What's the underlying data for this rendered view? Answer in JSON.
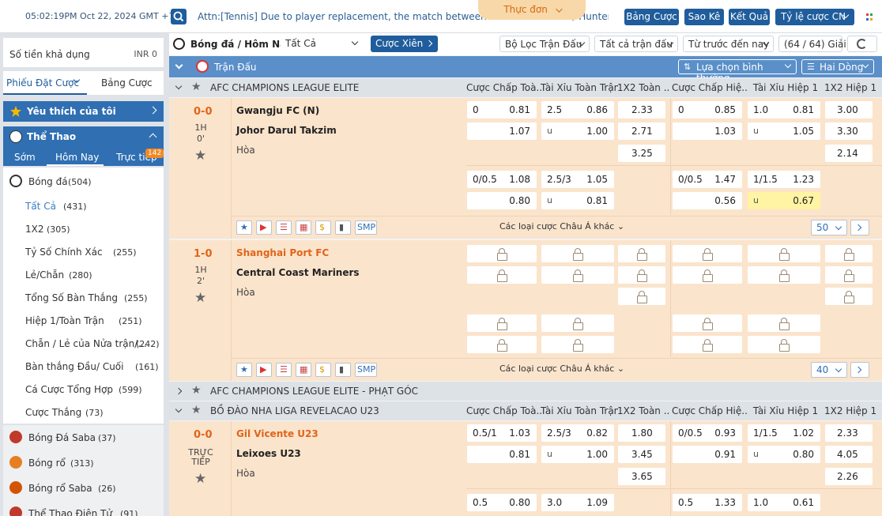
{
  "topbar": {
    "time": "05:02:19PM Oct 22, 2024 GMT +7",
    "marquee": "Attn:[Tennis] Due to player replacement, the match between \"Didi Bredenbach/ Hunter Heck\" vs- Tian",
    "menu_label": "Thực đơn",
    "buttons": [
      "Bảng Cược",
      "Sao Kê",
      "Kết Quả",
      "Tỷ lệ cược CN"
    ]
  },
  "sidebar": {
    "balance_label": "Số tiền khả dụng",
    "balance_value": "INR 0",
    "tabs": [
      "Phiếu Đặt Cược",
      "Bảng Cược"
    ],
    "favorites": "Yêu thích của tôi",
    "sports_title": "Thể Thao",
    "sport_tabs": [
      "Sớm",
      "Hôm Nay",
      "Trực tiếp"
    ],
    "live_badge": "142",
    "football": {
      "label": "Bóng đá",
      "count": "(504)"
    },
    "sub_items": [
      {
        "label": "Tất Cả",
        "count": "(431)"
      },
      {
        "label": "1X2",
        "count": "(305)"
      },
      {
        "label": "Tỷ Số Chính Xác",
        "count": "(255)"
      },
      {
        "label": "Lẻ/Chẵn",
        "count": "(280)"
      },
      {
        "label": "Tổng Số Bàn Thắng",
        "count": "(255)"
      },
      {
        "label": "Hiệp 1/Toàn Trận",
        "count": "(251)"
      },
      {
        "label": "Chẵn / Lẻ của Nửa trận/...",
        "count": "(242)"
      },
      {
        "label": "Bàn thắng Đầu/ Cuối",
        "count": "(161)"
      },
      {
        "label": "Cá Cược Tổng Hợp",
        "count": "(599)"
      },
      {
        "label": "Cược Thắng",
        "count": "(73)"
      }
    ],
    "sports": [
      {
        "label": "Bóng Đá Saba",
        "count": "(37)"
      },
      {
        "label": "Bóng rổ",
        "count": "(313)"
      },
      {
        "label": "Bóng rổ Saba",
        "count": "(26)"
      },
      {
        "label": "Thể Thao Điện Tử",
        "count": "(91)"
      }
    ]
  },
  "main": {
    "breadcrumb": "Bóng đá / Hôm Nay",
    "filter_all": "Tất Cả",
    "parlay": "Cược Xiên",
    "filter_match": "Bộ Lọc Trận Đấu",
    "filter_all_matches": "Tất cả trận đấu",
    "filter_earlier": "Từ trước đến nay",
    "league_count": "(64 / 64) Giải",
    "section_title": "Trận Đấu",
    "sort_label": "Lựa chọn bình thường",
    "view_label": "Hai Dòng",
    "col_headers": [
      "Cược Chấp Toà...",
      "Tài Xỉu Toàn Trận",
      "1X2 Toàn ...",
      "Cược Chấp Hiệ...",
      "Tài Xỉu Hiệp 1",
      "1X2 Hiệp 1"
    ],
    "other_bets": "Các loại cược Châu Á khác",
    "leagues": [
      {
        "name": "AFC CHAMPIONS LEAGUE ELITE"
      },
      {
        "name": "AFC CHAMPIONS LEAGUE ELITE - PHẠT GÓC"
      },
      {
        "name": "BỒ ĐÀO NHA LIGA REVELACAO U23"
      }
    ],
    "matches": [
      {
        "score": "0-0",
        "period": "1H",
        "minute": "0'",
        "home": "Gwangju FC (N)",
        "away": "Johor Darul Takzim",
        "draw": "Hòa",
        "more": "50",
        "r1": [
          "0",
          "0.81",
          "2.5",
          "0.86",
          "2.33",
          "0",
          "0.85",
          "1.0",
          "0.81",
          "3.00"
        ],
        "r2": [
          "1.07",
          "u",
          "1.00",
          "2.71",
          "1.03",
          "u",
          "1.05",
          "3.30"
        ],
        "r3": [
          "3.25",
          "2.14"
        ],
        "r4": [
          "0/0.5",
          "1.08",
          "2.5/3",
          "1.05",
          "0/0.5",
          "1.47",
          "1/1.5",
          "1.23"
        ],
        "r5": [
          "0.80",
          "u",
          "0.81",
          "0.56",
          "u",
          "0.67"
        ]
      },
      {
        "score": "1-0",
        "period": "1H",
        "minute": "2'",
        "home": "Shanghai Port FC",
        "away": "Central Coast Mariners",
        "draw": "Hòa",
        "more": "40"
      },
      {
        "score": "0-0",
        "period": "TRỰC",
        "minute": "TIẾP",
        "home": "Gil Vicente U23",
        "away": "Leixoes U23",
        "draw": "Hòa",
        "r1": [
          "0.5/1",
          "1.03",
          "2.5/3",
          "0.82",
          "1.80",
          "0/0.5",
          "0.93",
          "1/1.5",
          "1.02",
          "2.33"
        ],
        "r2": [
          "0.81",
          "u",
          "1.00",
          "3.45",
          "0.91",
          "u",
          "0.80",
          "4.05"
        ],
        "r3": [
          "3.65",
          "2.26"
        ],
        "r4": [
          "0.5",
          "0.80",
          "3.0",
          "1.09",
          "0.5",
          "1.33",
          "1.0",
          "0.61"
        ]
      }
    ],
    "smp": "SMP"
  }
}
